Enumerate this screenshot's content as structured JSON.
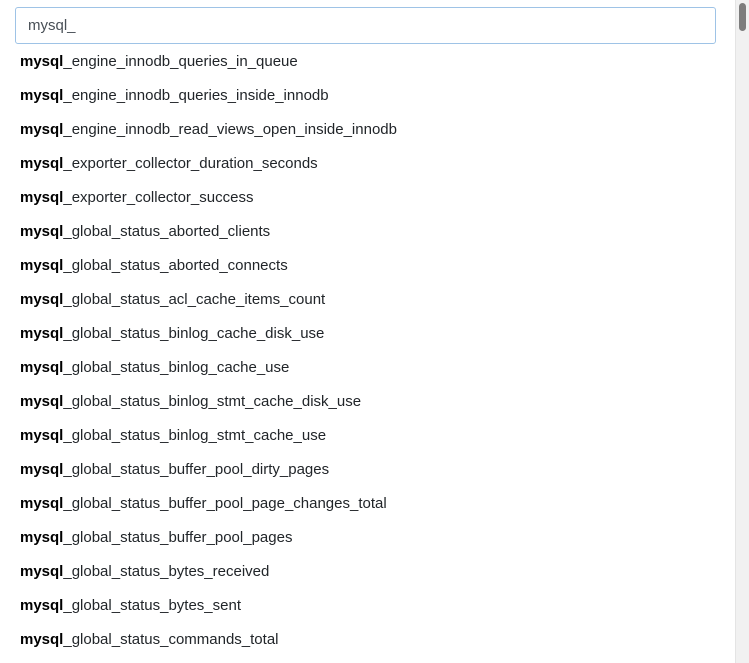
{
  "search": {
    "value": "mysql_",
    "placeholder": ""
  },
  "suggestions": [
    {
      "match": "mysql",
      "rest": "_engine_innodb_queries_in_queue"
    },
    {
      "match": "mysql",
      "rest": "_engine_innodb_queries_inside_innodb"
    },
    {
      "match": "mysql",
      "rest": "_engine_innodb_read_views_open_inside_innodb"
    },
    {
      "match": "mysql",
      "rest": "_exporter_collector_duration_seconds"
    },
    {
      "match": "mysql",
      "rest": "_exporter_collector_success"
    },
    {
      "match": "mysql",
      "rest": "_global_status_aborted_clients"
    },
    {
      "match": "mysql",
      "rest": "_global_status_aborted_connects"
    },
    {
      "match": "mysql",
      "rest": "_global_status_acl_cache_items_count"
    },
    {
      "match": "mysql",
      "rest": "_global_status_binlog_cache_disk_use"
    },
    {
      "match": "mysql",
      "rest": "_global_status_binlog_cache_use"
    },
    {
      "match": "mysql",
      "rest": "_global_status_binlog_stmt_cache_disk_use"
    },
    {
      "match": "mysql",
      "rest": "_global_status_binlog_stmt_cache_use"
    },
    {
      "match": "mysql",
      "rest": "_global_status_buffer_pool_dirty_pages"
    },
    {
      "match": "mysql",
      "rest": "_global_status_buffer_pool_page_changes_total"
    },
    {
      "match": "mysql",
      "rest": "_global_status_buffer_pool_pages"
    },
    {
      "match": "mysql",
      "rest": "_global_status_bytes_received"
    },
    {
      "match": "mysql",
      "rest": "_global_status_bytes_sent"
    },
    {
      "match": "mysql",
      "rest": "_global_status_commands_total"
    }
  ],
  "colors": {
    "input_border": "#9ec3e6",
    "text": "#212529",
    "scroll_thumb": "#7d7d7d"
  }
}
